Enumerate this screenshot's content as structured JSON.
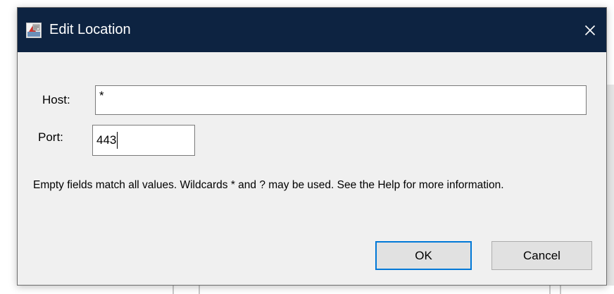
{
  "dialog": {
    "title": "Edit Location",
    "close_label": "×",
    "icon": "java-app-icon"
  },
  "form": {
    "host_label": "Host:",
    "host_value": "*",
    "port_label": "Port:",
    "port_value": "443"
  },
  "help_text": "Empty fields match all values. Wildcards * and ? may be used. See the Help for more information.",
  "buttons": {
    "ok_label": "OK",
    "cancel_label": "Cancel"
  },
  "colors": {
    "titlebar": "#0d2341",
    "dialog_bg": "#f0f0f0",
    "focus_accent": "#0078d7"
  }
}
